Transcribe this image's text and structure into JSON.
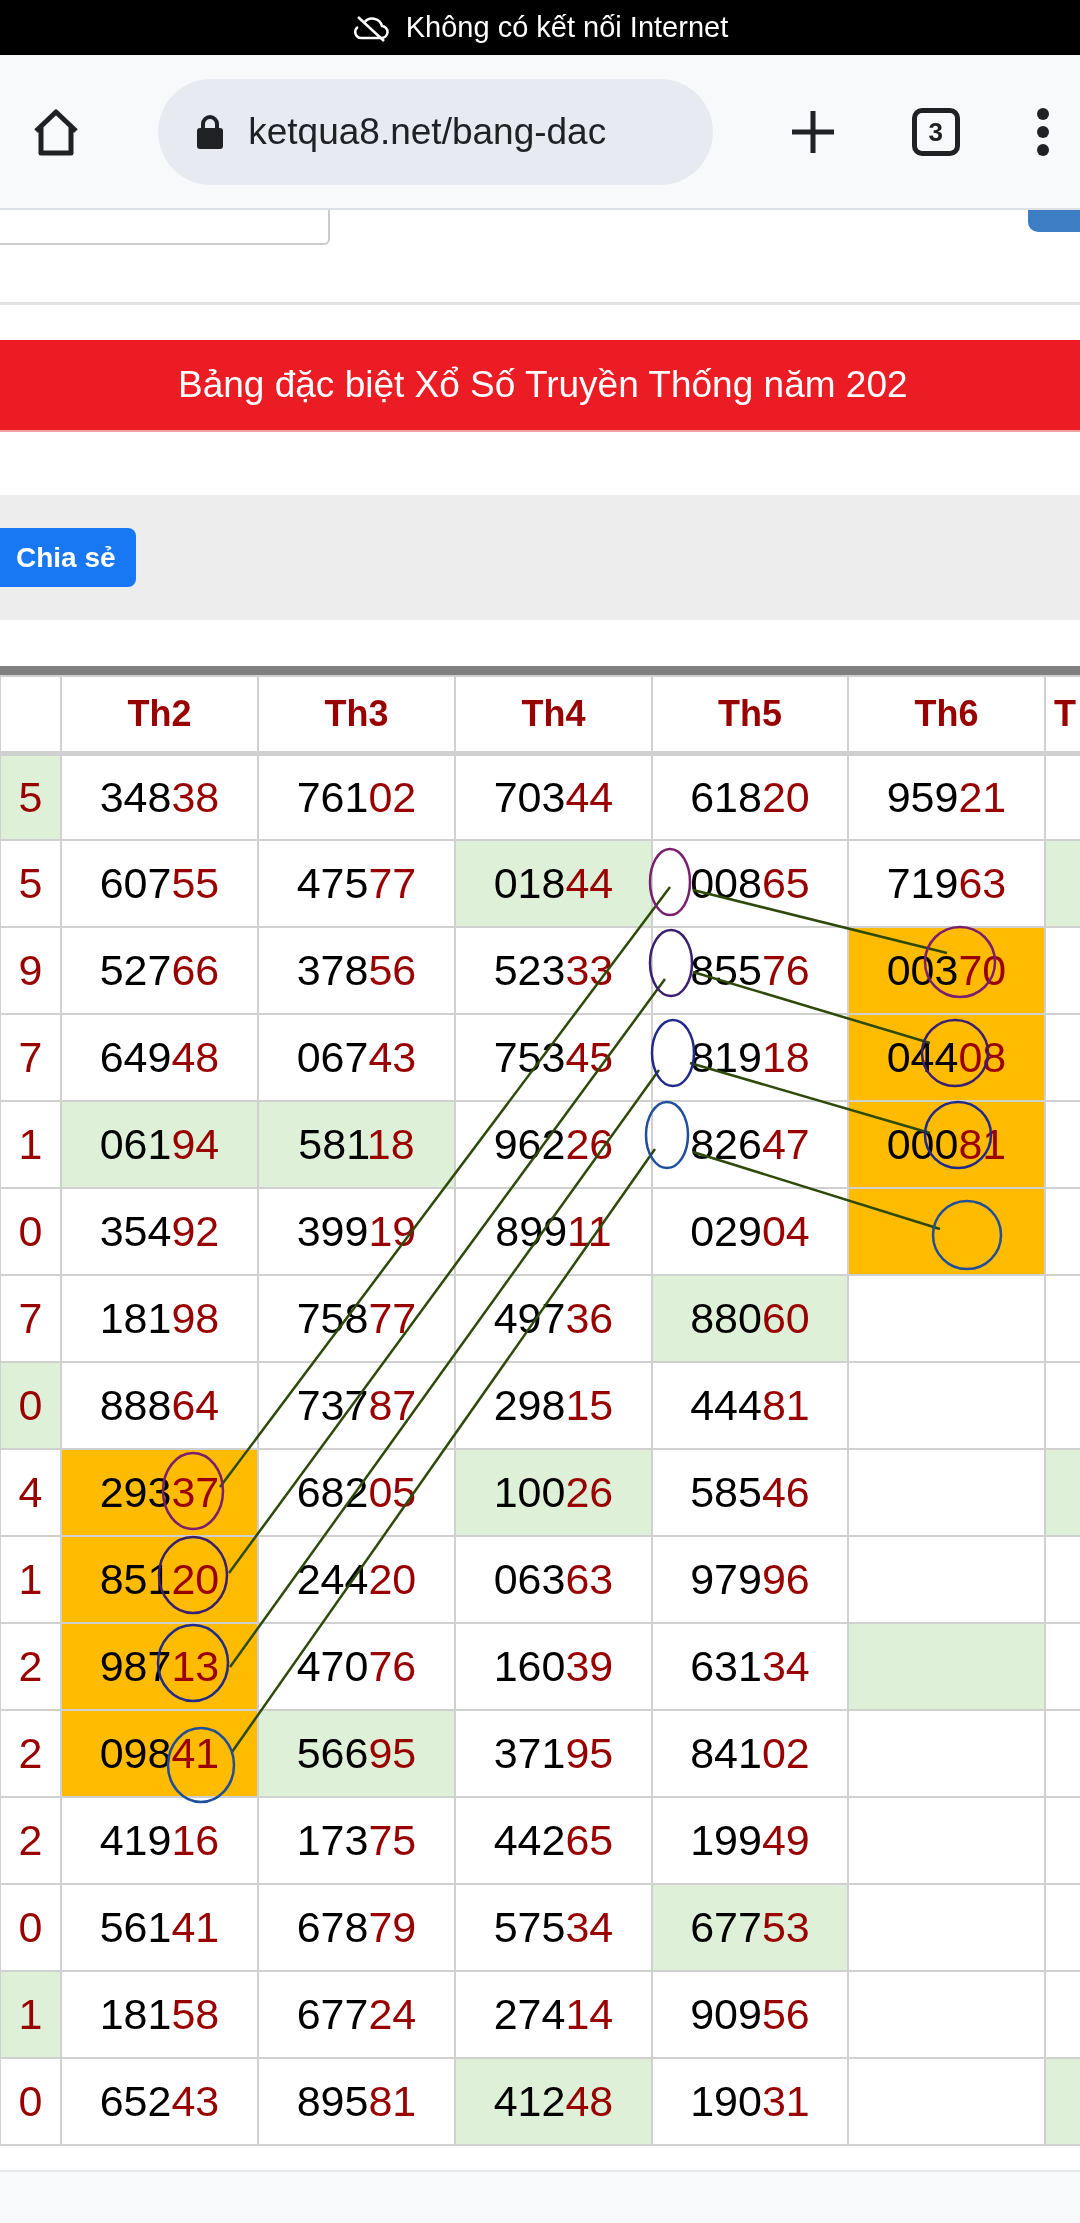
{
  "status_bar": {
    "message": "Không có kết nối Internet"
  },
  "browser": {
    "url": "ketqua8.net/bang-dac",
    "tab_count": "3"
  },
  "banner": {
    "title": "Bảng đặc biệt Xổ Số Truyền Thống năm 202"
  },
  "share_button": {
    "label": "Chia sẻ"
  },
  "table": {
    "columns": [
      "",
      "Th2",
      "Th3",
      "Th4",
      "Th5",
      "Th6",
      "T"
    ],
    "rows": [
      {
        "cells": [
          {
            "value": "5",
            "color": "#dff0d8"
          },
          {
            "value": "34838"
          },
          {
            "value": "76102"
          },
          {
            "value": "70344"
          },
          {
            "value": "61820"
          },
          {
            "value": "95921"
          },
          {}
        ]
      },
      {
        "cells": [
          {
            "value": "5"
          },
          {
            "value": "60755"
          },
          {
            "value": "47577"
          },
          {
            "value": "01844",
            "color": "#dff0d8"
          },
          {
            "value": "00865"
          },
          {
            "value": "71963"
          },
          {
            "color": "#dff0d8"
          }
        ]
      },
      {
        "cells": [
          {
            "value": "9"
          },
          {
            "value": "52766"
          },
          {
            "value": "37856"
          },
          {
            "value": "52333"
          },
          {
            "value": "85576"
          },
          {
            "value": "00370",
            "color": "#ffbb00"
          },
          {}
        ]
      },
      {
        "cells": [
          {
            "value": "7"
          },
          {
            "value": "64948"
          },
          {
            "value": "06743"
          },
          {
            "value": "75345"
          },
          {
            "value": "81918"
          },
          {
            "value": "04408",
            "color": "#ffbb00"
          },
          {}
        ]
      },
      {
        "cells": [
          {
            "value": "1"
          },
          {
            "value": "06194",
            "color": "#dff0d8"
          },
          {
            "value": "58118",
            "color": "#dff0d8"
          },
          {
            "value": "96226"
          },
          {
            "value": "82647"
          },
          {
            "value": "00081",
            "color": "#ffbb00"
          },
          {}
        ]
      },
      {
        "cells": [
          {
            "value": "0"
          },
          {
            "value": "35492"
          },
          {
            "value": "39919"
          },
          {
            "value": "89911"
          },
          {
            "value": "02904"
          },
          {
            "color": "#ffbb00"
          },
          {}
        ]
      },
      {
        "cells": [
          {
            "value": "7"
          },
          {
            "value": "18198"
          },
          {
            "value": "75877"
          },
          {
            "value": "49736"
          },
          {
            "value": "88060",
            "color": "#dff0d8"
          },
          {},
          {}
        ]
      },
      {
        "cells": [
          {
            "value": "0",
            "color": "#dff0d8"
          },
          {
            "value": "88864"
          },
          {
            "value": "73787"
          },
          {
            "value": "29815"
          },
          {
            "value": "44481"
          },
          {},
          {}
        ]
      },
      {
        "cells": [
          {
            "value": "4"
          },
          {
            "value": "29337",
            "color": "#ffbb00"
          },
          {
            "value": "68205"
          },
          {
            "value": "10026",
            "color": "#dff0d8"
          },
          {
            "value": "58546"
          },
          {},
          {
            "color": "#dff0d8"
          }
        ]
      },
      {
        "cells": [
          {
            "value": "1"
          },
          {
            "value": "85120",
            "color": "#ffbb00"
          },
          {
            "value": "24420"
          },
          {
            "value": "06363"
          },
          {
            "value": "97996"
          },
          {},
          {}
        ]
      },
      {
        "cells": [
          {
            "value": "2"
          },
          {
            "value": "98713",
            "color": "#ffbb00"
          },
          {
            "value": "47076"
          },
          {
            "value": "16039"
          },
          {
            "value": "63134"
          },
          {
            "color": "#dff0d8"
          },
          {}
        ]
      },
      {
        "cells": [
          {
            "value": "2"
          },
          {
            "value": "09841",
            "color": "#ffbb00"
          },
          {
            "value": "56695",
            "color": "#dff0d8"
          },
          {
            "value": "37195"
          },
          {
            "value": "84102"
          },
          {},
          {}
        ]
      },
      {
        "cells": [
          {
            "value": "2"
          },
          {
            "value": "41916"
          },
          {
            "value": "17375"
          },
          {
            "value": "44265"
          },
          {
            "value": "19949"
          },
          {},
          {}
        ]
      },
      {
        "cells": [
          {
            "value": "0"
          },
          {
            "value": "56141"
          },
          {
            "value": "67879"
          },
          {
            "value": "57534"
          },
          {
            "value": "67753",
            "color": "#dff0d8"
          },
          {},
          {}
        ]
      },
      {
        "cells": [
          {
            "value": "1",
            "color": "#dff0d8"
          },
          {
            "value": "18158"
          },
          {
            "value": "67724"
          },
          {
            "value": "27414"
          },
          {
            "value": "90956"
          },
          {},
          {}
        ]
      },
      {
        "cells": [
          {
            "value": "0"
          },
          {
            "value": "65243"
          },
          {
            "value": "89581"
          },
          {
            "value": "41248",
            "color": "#dff0d8"
          },
          {
            "value": "19031"
          },
          {},
          {
            "color": "#dff0d8"
          }
        ]
      }
    ]
  }
}
